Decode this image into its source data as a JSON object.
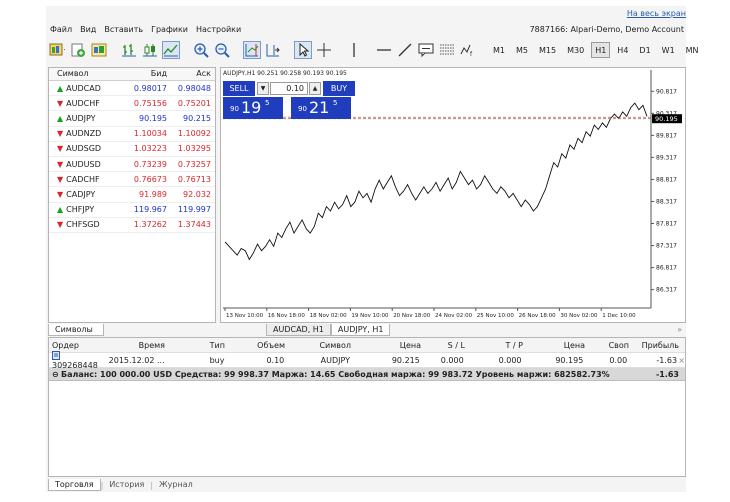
{
  "header": {
    "fullscreen_link": "На весь экран",
    "account_info": "7887166: Alpari-Demo, Demo Account"
  },
  "menu": [
    "Файл",
    "Вид",
    "Вставить",
    "Графики",
    "Настройки"
  ],
  "timeframes": [
    {
      "label": "M1",
      "active": false
    },
    {
      "label": "M5",
      "active": false
    },
    {
      "label": "M15",
      "active": false
    },
    {
      "label": "M30",
      "active": false
    },
    {
      "label": "H1",
      "active": true
    },
    {
      "label": "H4",
      "active": false
    },
    {
      "label": "D1",
      "active": false
    },
    {
      "label": "W1",
      "active": false
    },
    {
      "label": "MN",
      "active": false
    }
  ],
  "symbols": {
    "headers": {
      "symbol": "Символ",
      "bid": "Бид",
      "ask": "Аск"
    },
    "rows": [
      {
        "symbol": "AUDCAD",
        "bid": "0.98017",
        "ask": "0.98048",
        "dir": "up"
      },
      {
        "symbol": "AUDCHF",
        "bid": "0.75156",
        "ask": "0.75201",
        "dir": "down"
      },
      {
        "symbol": "AUDJPY",
        "bid": "90.195",
        "ask": "90.215",
        "dir": "up"
      },
      {
        "symbol": "AUDNZD",
        "bid": "1.10034",
        "ask": "1.10092",
        "dir": "down"
      },
      {
        "symbol": "AUDSGD",
        "bid": "1.03223",
        "ask": "1.03295",
        "dir": "down"
      },
      {
        "symbol": "AUDUSD",
        "bid": "0.73239",
        "ask": "0.73257",
        "dir": "down"
      },
      {
        "symbol": "CADCHF",
        "bid": "0.76673",
        "ask": "0.76713",
        "dir": "down"
      },
      {
        "symbol": "CADJPY",
        "bid": "91.989",
        "ask": "92.032",
        "dir": "down"
      },
      {
        "symbol": "CHFJPY",
        "bid": "119.967",
        "ask": "119.997",
        "dir": "up"
      },
      {
        "symbol": "CHFSGD",
        "bid": "1.37262",
        "ask": "1.37443",
        "dir": "down"
      }
    ],
    "tab_label": "Символы"
  },
  "chart": {
    "caption": "AUDJPY,H1  90.251 90.258 90.193 90.195",
    "sell_label": "SELL",
    "buy_label": "BUY",
    "lot": "0.10",
    "lot_down": "▼",
    "lot_up": "▲",
    "sell_price_small": "90",
    "sell_price_big": "19",
    "sell_price_sup": "5",
    "buy_price_small": "90",
    "buy_price_big": "21",
    "buy_price_sup": "5",
    "tabs": [
      {
        "label": "AUDCAD, H1",
        "active": false
      },
      {
        "label": "AUDJPY, H1",
        "active": true
      }
    ],
    "tabs_arrow": "»"
  },
  "chart_data": {
    "type": "line",
    "title": "AUDJPY,H1",
    "current_price": "90.195",
    "y_ticks": [
      "90.817",
      "90.317",
      "89.817",
      "89.317",
      "88.817",
      "88.317",
      "87.817",
      "87.317",
      "86.817",
      "86.317"
    ],
    "y_tick_values": [
      90.817,
      90.317,
      89.817,
      89.317,
      88.817,
      88.317,
      87.817,
      87.317,
      86.817,
      86.317
    ],
    "ylim": [
      85.9,
      91.3
    ],
    "x_ticks": [
      "13 Nov 10:00",
      "16 Nov 18:00",
      "18 Nov 02:00",
      "19 Nov 10:00",
      "20 Nov 18:00",
      "24 Nov 02:00",
      "25 Nov 10:00",
      "26 Nov 18:00",
      "30 Nov 02:00",
      "1 Dec 10:00"
    ],
    "values": [
      87.4,
      87.3,
      87.2,
      87.1,
      87.25,
      87.2,
      87.0,
      87.15,
      87.35,
      87.2,
      87.3,
      87.45,
      87.3,
      87.6,
      87.5,
      87.7,
      87.85,
      87.6,
      87.75,
      87.9,
      87.7,
      87.6,
      87.75,
      88.05,
      87.95,
      88.2,
      88.1,
      88.3,
      88.15,
      88.25,
      88.45,
      88.2,
      88.3,
      88.55,
      88.4,
      88.5,
      88.3,
      88.6,
      88.8,
      88.6,
      88.75,
      88.9,
      88.65,
      88.45,
      88.55,
      88.7,
      88.5,
      88.35,
      88.5,
      88.65,
      88.5,
      88.6,
      88.75,
      88.55,
      88.7,
      88.85,
      88.6,
      88.75,
      89.0,
      88.85,
      88.7,
      88.8,
      88.6,
      88.7,
      88.9,
      88.75,
      88.6,
      88.5,
      88.65,
      88.55,
      88.4,
      88.5,
      88.35,
      88.2,
      88.35,
      88.25,
      88.1,
      88.2,
      88.4,
      88.6,
      88.9,
      89.2,
      89.1,
      89.4,
      89.3,
      89.6,
      89.5,
      89.75,
      89.65,
      89.9,
      89.8,
      90.05,
      89.95,
      90.1,
      90.0,
      90.2,
      90.3,
      90.2,
      90.35,
      90.25,
      90.45,
      90.55,
      90.4,
      90.5,
      90.25
    ]
  },
  "orders": {
    "headers": [
      "Ордер",
      "Время",
      "Тип",
      "Объем",
      "Символ",
      "Цена",
      "S / L",
      "T / P",
      "Цена",
      "Своп",
      "Прибыль"
    ],
    "row": {
      "order": "309268448",
      "time": "2015.12.02 ...",
      "type": "buy",
      "volume": "0.10",
      "symbol": "AUDJPY",
      "price": "90.215",
      "sl": "0.000",
      "tp": "0.000",
      "current_price": "90.195",
      "swap": "0.00",
      "profit": "-1.63",
      "close": "×"
    },
    "balance_text": "Баланс: 100 000.00 USD  Средства: 99 998.37  Маржа: 14.65  Свободная маржа: 99 983.72  Уровень маржи: 682582.73%",
    "balance_profit": "-1.63",
    "balance_icon": "⊖"
  },
  "bottom_tabs": [
    {
      "label": "Торговля",
      "active": true
    },
    {
      "label": "История",
      "active": false
    },
    {
      "label": "Журнал",
      "active": false
    }
  ],
  "colors": {
    "accent": "#1f3dbd",
    "up": "#18a318",
    "down": "#d8262a",
    "bid_ask_up": "#1f33cc"
  }
}
